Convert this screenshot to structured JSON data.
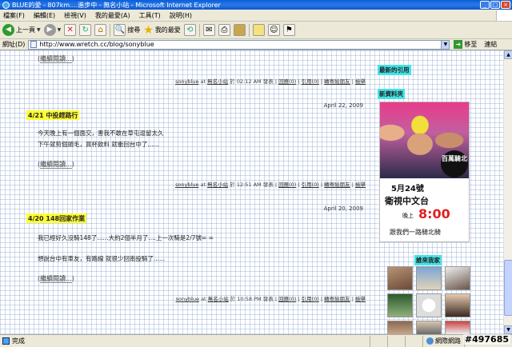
{
  "window": {
    "title": "BLUE的愛 - 807km....進步中 - 無名小站 - Microsoft Internet Explorer",
    "minimize": "_",
    "maximize": "□",
    "close": "×"
  },
  "menu": [
    "檔案(F)",
    "編輯(E)",
    "檢視(V)",
    "我的最愛(A)",
    "工具(T)",
    "說明(H)"
  ],
  "toolbar": {
    "back_label": "上一頁",
    "search_label": "搜尋",
    "favorites_label": "我的最愛"
  },
  "address": {
    "label": "網址(D)",
    "url": "http://www.wretch.cc/blog/sonyblue",
    "go_label": "移至",
    "links_label": "連結"
  },
  "content": {
    "read_more": "繼續閱讀...",
    "footers": [
      {
        "author": "sonyblue",
        "at": "at",
        "site": "無名小站",
        "on": "於",
        "time": "02:12 AM",
        "post": "發表",
        "reply": "回應(0)",
        "trackback": "引用(0)",
        "recommend": "轉寄給朋友",
        "report": "檢舉"
      },
      {
        "author": "sonyblue",
        "at": "at",
        "site": "無名小站",
        "on": "於",
        "time": "12:51 AM",
        "post": "發表",
        "reply": "回應(0)",
        "trackback": "引用(0)",
        "recommend": "轉寄給朋友",
        "report": "檢舉"
      },
      {
        "author": "sonyblue",
        "at": "at",
        "site": "無名小站",
        "on": "於",
        "time": "10:58 PM",
        "post": "發表",
        "reply": "回應(0)",
        "trackback": "引用(0)",
        "recommend": "轉寄給朋友",
        "report": "檢舉"
      }
    ],
    "posts": [
      {
        "date": "April 22, 2009",
        "title": "4/21 中投趕路行",
        "lines": [
          "今天晚上有一個面交，害我不敢在草屯逗留太久",
          "下午就剪個頭毛，買杯飲料 就衝回台中了......"
        ]
      },
      {
        "date": "April 20, 2009",
        "title": "4/20 148回家作業",
        "lines": [
          "我已經好久沒騎148了......大約2個半月了....上一次騎是2/7號= =",
          "想說台中有車友，有路線 就很少回南投騎了......"
        ]
      }
    ]
  },
  "sidebar": {
    "recent_trackbacks": "最新的引用",
    "new_files": "新資料夾",
    "visitors": "誰來我家",
    "banner": {
      "badge": "百萬騎北",
      "date": "5月24號",
      "channel": "衛視中文台",
      "time_prefix": "晚上",
      "time": "8:00",
      "slogan": "跟我們一路騎北騎"
    }
  },
  "status": {
    "text": "完成",
    "zone": "網際網路",
    "watermark": "#497685"
  },
  "colors": {
    "title_highlight": "#ffff33",
    "sidebar_highlight": "#45e3e8",
    "ie_blue": "#0a5fd8"
  }
}
